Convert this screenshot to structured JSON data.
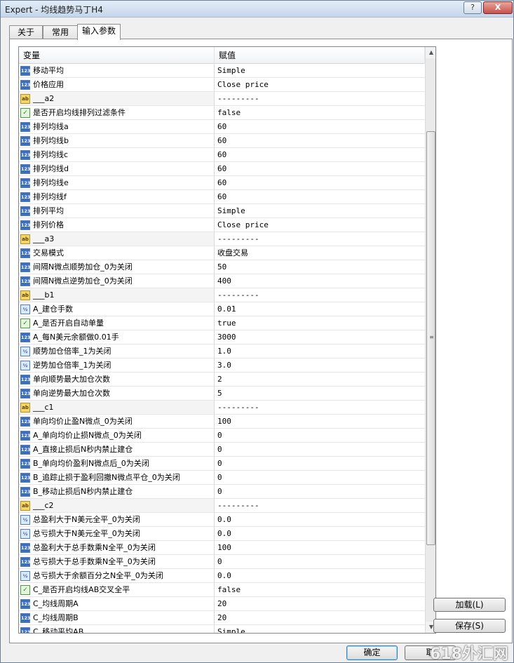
{
  "window": {
    "title": "Expert - 均线趋势马丁H4",
    "help": "?",
    "close": "X"
  },
  "tabs": [
    {
      "label": "关于"
    },
    {
      "label": "常用"
    },
    {
      "label": "输入参数"
    }
  ],
  "grid": {
    "headers": {
      "variable": "变量",
      "value": "赋值"
    },
    "rows": [
      {
        "type": "123",
        "name": "移动平均",
        "value": "Simple"
      },
      {
        "type": "123",
        "name": "价格应用",
        "value": "Close price"
      },
      {
        "type": "ab",
        "name": "___a2",
        "value": "---------"
      },
      {
        "type": "bool",
        "name": "是否开启均线排列过滤条件",
        "value": "false"
      },
      {
        "type": "123",
        "name": "排列均线a",
        "value": "60"
      },
      {
        "type": "123",
        "name": "排列均线b",
        "value": "60"
      },
      {
        "type": "123",
        "name": "排列均线c",
        "value": "60"
      },
      {
        "type": "123",
        "name": "排列均线d",
        "value": "60"
      },
      {
        "type": "123",
        "name": "排列均线e",
        "value": "60"
      },
      {
        "type": "123",
        "name": "排列均线f",
        "value": "60"
      },
      {
        "type": "123",
        "name": "排列平均",
        "value": "Simple"
      },
      {
        "type": "123",
        "name": "排列价格",
        "value": "Close price"
      },
      {
        "type": "ab",
        "name": "___a3",
        "value": "---------"
      },
      {
        "type": "123",
        "name": "交易模式",
        "value": "收盘交易"
      },
      {
        "type": "123",
        "name": "间隔N微点顺势加仓_0为关闭",
        "value": "50"
      },
      {
        "type": "123",
        "name": "间隔N微点逆势加仓_0为关闭",
        "value": "400"
      },
      {
        "type": "ab",
        "name": "___b1",
        "value": "---------"
      },
      {
        "type": "dbl",
        "name": "A_建仓手数",
        "value": "0.01"
      },
      {
        "type": "bool",
        "name": "A_是否开启自动单量",
        "value": "true"
      },
      {
        "type": "123",
        "name": "A_每N美元余额做0.01手",
        "value": "3000"
      },
      {
        "type": "dbl",
        "name": "顺势加仓倍率_1为关闭",
        "value": "1.0"
      },
      {
        "type": "dbl",
        "name": "逆势加仓倍率_1为关闭",
        "value": "3.0"
      },
      {
        "type": "123",
        "name": "单向顺势最大加仓次数",
        "value": "2"
      },
      {
        "type": "123",
        "name": "单向逆势最大加仓次数",
        "value": "5"
      },
      {
        "type": "ab",
        "name": "___c1",
        "value": "---------"
      },
      {
        "type": "123",
        "name": "单向均价止盈N微点_0为关闭",
        "value": "100"
      },
      {
        "type": "123",
        "name": "A_单向均价止损N微点_0为关闭",
        "value": "0"
      },
      {
        "type": "123",
        "name": "A_直接止损后N秒内禁止建仓",
        "value": "0"
      },
      {
        "type": "123",
        "name": "B_单向均价盈利N微点后_0为关闭",
        "value": "0"
      },
      {
        "type": "123",
        "name": "B_追踪止损于盈利回撤N微点平仓_0为关闭",
        "value": "0"
      },
      {
        "type": "123",
        "name": "B_移动止损后N秒内禁止建仓",
        "value": "0"
      },
      {
        "type": "ab",
        "name": "___c2",
        "value": "---------"
      },
      {
        "type": "dbl",
        "name": "总盈利大于N美元全平_0为关闭",
        "value": "0.0"
      },
      {
        "type": "dbl",
        "name": "总亏损大于N美元全平_0为关闭",
        "value": "0.0"
      },
      {
        "type": "123",
        "name": "总盈利大于总手数乘N全平_0为关闭",
        "value": "100"
      },
      {
        "type": "123",
        "name": "总亏损大于总手数乘N全平_0为关闭",
        "value": "0"
      },
      {
        "type": "dbl",
        "name": "总亏损大于余额百分之N全平_0为关闭",
        "value": "0.0"
      },
      {
        "type": "bool",
        "name": "C_是否开启均线AB交叉全平",
        "value": "false"
      },
      {
        "type": "123",
        "name": "C_均线周期A",
        "value": "20"
      },
      {
        "type": "123",
        "name": "C_均线周期B",
        "value": "20"
      },
      {
        "type": "123",
        "name": "C_移动平均AB",
        "value": "Simple"
      }
    ]
  },
  "icons": {
    "123": "123",
    "ab": "ab",
    "bool": "✓",
    "dbl": "½"
  },
  "scrollbar": {
    "up": "▲",
    "down": "▼",
    "grip": "≡"
  },
  "buttons": {
    "load": "加载(L)",
    "save": "保存(S)",
    "ok": "确定",
    "cancel": "取"
  },
  "watermark": "618外汇网"
}
